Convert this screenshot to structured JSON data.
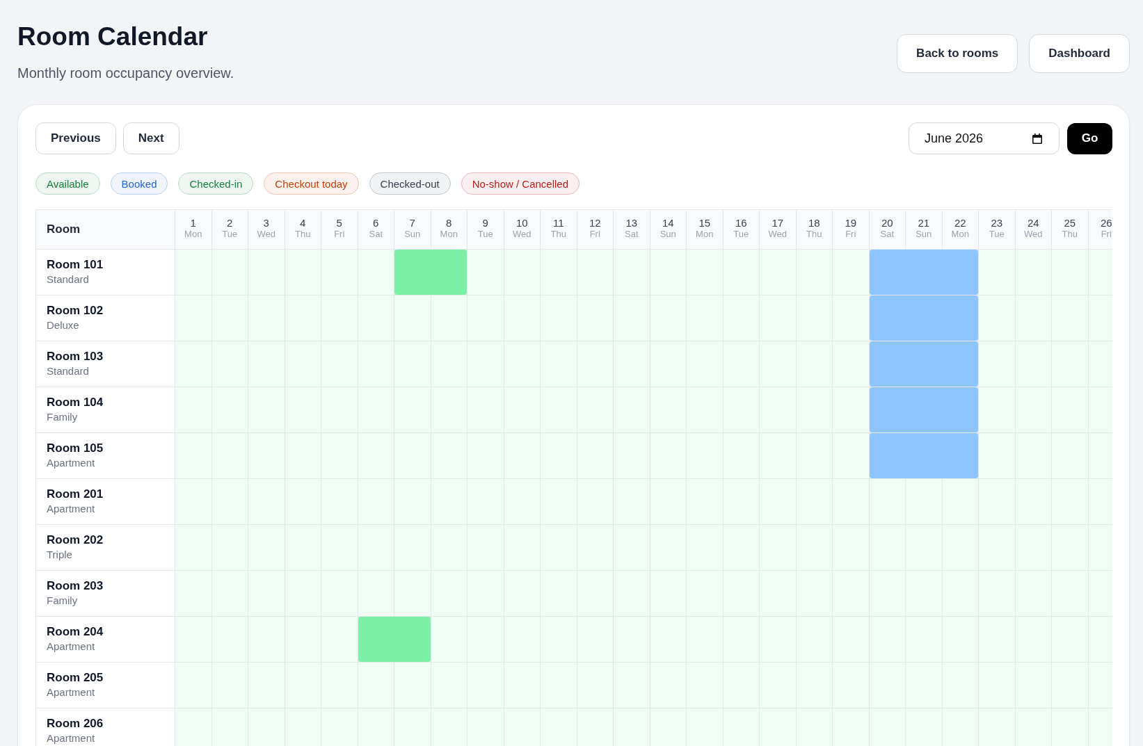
{
  "header": {
    "title": "Room Calendar",
    "subtitle": "Monthly room occupancy overview.",
    "buttons": [
      "Back to rooms",
      "Dashboard"
    ]
  },
  "toolbar": {
    "nav_buttons": [
      "Previous",
      "Next"
    ],
    "month_field": {
      "value": "June 2026"
    },
    "go_button": "Go"
  },
  "legend": [
    {
      "label": "Available",
      "color": "#15803d"
    },
    {
      "label": "Booked",
      "color": "#1d68d1"
    },
    {
      "label": "Checked-in",
      "color": "#15803d"
    },
    {
      "label": "Checkout today",
      "color": "#c2410c"
    },
    {
      "label": "Checked-out",
      "color": "#374151"
    },
    {
      "label": "No-show / Cancelled",
      "color": "#b91c1c"
    }
  ],
  "calendar": {
    "room_heading": "Room",
    "days": [
      {
        "date": "1",
        "weekday": "Mon"
      },
      {
        "date": "2",
        "weekday": "Tue"
      },
      {
        "date": "3",
        "weekday": "Wed"
      },
      {
        "date": "4",
        "weekday": "Thu"
      },
      {
        "date": "5",
        "weekday": "Fri"
      },
      {
        "date": "6",
        "weekday": "Sat"
      },
      {
        "date": "7",
        "weekday": "Sun"
      },
      {
        "date": "8",
        "weekday": "Mon"
      },
      {
        "date": "9",
        "weekday": "Tue"
      },
      {
        "date": "10",
        "weekday": "Wed"
      },
      {
        "date": "11",
        "weekday": "Thu"
      },
      {
        "date": "12",
        "weekday": "Fri"
      },
      {
        "date": "13",
        "weekday": "Sat"
      },
      {
        "date": "14",
        "weekday": "Sun"
      },
      {
        "date": "15",
        "weekday": "Mon"
      },
      {
        "date": "16",
        "weekday": "Tue"
      },
      {
        "date": "17",
        "weekday": "Wed"
      },
      {
        "date": "18",
        "weekday": "Thu"
      },
      {
        "date": "19",
        "weekday": "Fri"
      },
      {
        "date": "20",
        "weekday": "Sat"
      },
      {
        "date": "21",
        "weekday": "Sun"
      },
      {
        "date": "22",
        "weekday": "Mon"
      },
      {
        "date": "23",
        "weekday": "Tue"
      },
      {
        "date": "24",
        "weekday": "Wed"
      },
      {
        "date": "25",
        "weekday": "Thu"
      },
      {
        "date": "26",
        "weekday": "Fri"
      }
    ],
    "rooms": [
      {
        "name": "Room 101",
        "type": "Standard",
        "cells": [
          {
            "kind": "available"
          },
          {
            "kind": "available"
          },
          {
            "kind": "available"
          },
          {
            "kind": "available"
          },
          {
            "kind": "available"
          },
          {
            "kind": "available"
          },
          {
            "kind": "checked-in"
          },
          {
            "kind": "checked-in"
          },
          {
            "kind": "available"
          },
          {
            "kind": "available"
          },
          {
            "kind": "available"
          },
          {
            "kind": "available"
          },
          {
            "kind": "available"
          },
          {
            "kind": "available"
          },
          {
            "kind": "available"
          },
          {
            "kind": "available"
          },
          {
            "kind": "available"
          },
          {
            "kind": "available"
          },
          {
            "kind": "available"
          },
          {
            "kind": "booked"
          },
          {
            "kind": "booked"
          },
          {
            "kind": "booked"
          },
          {
            "kind": "available"
          },
          {
            "kind": "available"
          },
          {
            "kind": "available"
          },
          {
            "kind": "available"
          }
        ]
      },
      {
        "name": "Room 102",
        "type": "Deluxe",
        "cells": [
          {
            "kind": "available"
          },
          {
            "kind": "available"
          },
          {
            "kind": "available"
          },
          {
            "kind": "available"
          },
          {
            "kind": "available"
          },
          {
            "kind": "available"
          },
          {
            "kind": "available"
          },
          {
            "kind": "available"
          },
          {
            "kind": "available"
          },
          {
            "kind": "available"
          },
          {
            "kind": "available"
          },
          {
            "kind": "available"
          },
          {
            "kind": "available"
          },
          {
            "kind": "available"
          },
          {
            "kind": "available"
          },
          {
            "kind": "available"
          },
          {
            "kind": "available"
          },
          {
            "kind": "available"
          },
          {
            "kind": "available"
          },
          {
            "kind": "booked"
          },
          {
            "kind": "booked"
          },
          {
            "kind": "booked"
          },
          {
            "kind": "available"
          },
          {
            "kind": "available"
          },
          {
            "kind": "available"
          },
          {
            "kind": "available"
          }
        ]
      },
      {
        "name": "Room 103",
        "type": "Standard",
        "cells": [
          {
            "kind": "available"
          },
          {
            "kind": "available"
          },
          {
            "kind": "available"
          },
          {
            "kind": "available"
          },
          {
            "kind": "available"
          },
          {
            "kind": "available"
          },
          {
            "kind": "available"
          },
          {
            "kind": "available"
          },
          {
            "kind": "available"
          },
          {
            "kind": "available"
          },
          {
            "kind": "available"
          },
          {
            "kind": "available"
          },
          {
            "kind": "available"
          },
          {
            "kind": "available"
          },
          {
            "kind": "available"
          },
          {
            "kind": "available"
          },
          {
            "kind": "available"
          },
          {
            "kind": "available"
          },
          {
            "kind": "available"
          },
          {
            "kind": "booked"
          },
          {
            "kind": "booked"
          },
          {
            "kind": "booked"
          },
          {
            "kind": "available"
          },
          {
            "kind": "available"
          },
          {
            "kind": "available"
          },
          {
            "kind": "available"
          }
        ]
      },
      {
        "name": "Room 104",
        "type": "Family",
        "cells": [
          {
            "kind": "available"
          },
          {
            "kind": "available"
          },
          {
            "kind": "available"
          },
          {
            "kind": "available"
          },
          {
            "kind": "available"
          },
          {
            "kind": "available"
          },
          {
            "kind": "available"
          },
          {
            "kind": "available"
          },
          {
            "kind": "available"
          },
          {
            "kind": "available"
          },
          {
            "kind": "available"
          },
          {
            "kind": "available"
          },
          {
            "kind": "available"
          },
          {
            "kind": "available"
          },
          {
            "kind": "available"
          },
          {
            "kind": "available"
          },
          {
            "kind": "available"
          },
          {
            "kind": "available"
          },
          {
            "kind": "available"
          },
          {
            "kind": "booked"
          },
          {
            "kind": "booked"
          },
          {
            "kind": "booked"
          },
          {
            "kind": "available"
          },
          {
            "kind": "available"
          },
          {
            "kind": "available"
          },
          {
            "kind": "available"
          }
        ]
      },
      {
        "name": "Room 105",
        "type": "Apartment",
        "cells": [
          {
            "kind": "available"
          },
          {
            "kind": "available"
          },
          {
            "kind": "available"
          },
          {
            "kind": "available"
          },
          {
            "kind": "available"
          },
          {
            "kind": "available"
          },
          {
            "kind": "available"
          },
          {
            "kind": "available"
          },
          {
            "kind": "available"
          },
          {
            "kind": "available"
          },
          {
            "kind": "available"
          },
          {
            "kind": "available"
          },
          {
            "kind": "available"
          },
          {
            "kind": "available"
          },
          {
            "kind": "available"
          },
          {
            "kind": "available"
          },
          {
            "kind": "available"
          },
          {
            "kind": "available"
          },
          {
            "kind": "available"
          },
          {
            "kind": "booked"
          },
          {
            "kind": "booked"
          },
          {
            "kind": "booked"
          },
          {
            "kind": "available"
          },
          {
            "kind": "available"
          },
          {
            "kind": "available"
          },
          {
            "kind": "available"
          }
        ]
      },
      {
        "name": "Room 201",
        "type": "Apartment",
        "cells": [
          {
            "kind": "available"
          },
          {
            "kind": "available"
          },
          {
            "kind": "available"
          },
          {
            "kind": "available"
          },
          {
            "kind": "available"
          },
          {
            "kind": "available"
          },
          {
            "kind": "available"
          },
          {
            "kind": "available"
          },
          {
            "kind": "available"
          },
          {
            "kind": "available"
          },
          {
            "kind": "available"
          },
          {
            "kind": "available"
          },
          {
            "kind": "available"
          },
          {
            "kind": "available"
          },
          {
            "kind": "available"
          },
          {
            "kind": "available"
          },
          {
            "kind": "available"
          },
          {
            "kind": "available"
          },
          {
            "kind": "available"
          },
          {
            "kind": "available"
          },
          {
            "kind": "available"
          },
          {
            "kind": "available"
          },
          {
            "kind": "available"
          },
          {
            "kind": "available"
          },
          {
            "kind": "available"
          },
          {
            "kind": "available"
          }
        ]
      },
      {
        "name": "Room 202",
        "type": "Triple",
        "cells": [
          {
            "kind": "available"
          },
          {
            "kind": "available"
          },
          {
            "kind": "available"
          },
          {
            "kind": "available"
          },
          {
            "kind": "available"
          },
          {
            "kind": "available"
          },
          {
            "kind": "available"
          },
          {
            "kind": "available"
          },
          {
            "kind": "available"
          },
          {
            "kind": "available"
          },
          {
            "kind": "available"
          },
          {
            "kind": "available"
          },
          {
            "kind": "available"
          },
          {
            "kind": "available"
          },
          {
            "kind": "available"
          },
          {
            "kind": "available"
          },
          {
            "kind": "available"
          },
          {
            "kind": "available"
          },
          {
            "kind": "available"
          },
          {
            "kind": "available"
          },
          {
            "kind": "available"
          },
          {
            "kind": "available"
          },
          {
            "kind": "available"
          },
          {
            "kind": "available"
          },
          {
            "kind": "available"
          },
          {
            "kind": "available"
          }
        ]
      },
      {
        "name": "Room 203",
        "type": "Family",
        "cells": [
          {
            "kind": "available"
          },
          {
            "kind": "available"
          },
          {
            "kind": "available"
          },
          {
            "kind": "available"
          },
          {
            "kind": "available"
          },
          {
            "kind": "available"
          },
          {
            "kind": "available"
          },
          {
            "kind": "available"
          },
          {
            "kind": "available"
          },
          {
            "kind": "available"
          },
          {
            "kind": "available"
          },
          {
            "kind": "available"
          },
          {
            "kind": "available"
          },
          {
            "kind": "available"
          },
          {
            "kind": "available"
          },
          {
            "kind": "available"
          },
          {
            "kind": "available"
          },
          {
            "kind": "available"
          },
          {
            "kind": "available"
          },
          {
            "kind": "available"
          },
          {
            "kind": "available"
          },
          {
            "kind": "available"
          },
          {
            "kind": "available"
          },
          {
            "kind": "available"
          },
          {
            "kind": "available"
          },
          {
            "kind": "available"
          }
        ]
      },
      {
        "name": "Room 204",
        "type": "Apartment",
        "cells": [
          {
            "kind": "available"
          },
          {
            "kind": "available"
          },
          {
            "kind": "available"
          },
          {
            "kind": "available"
          },
          {
            "kind": "available"
          },
          {
            "kind": "checked-in"
          },
          {
            "kind": "checked-in"
          },
          {
            "kind": "available"
          },
          {
            "kind": "available"
          },
          {
            "kind": "available"
          },
          {
            "kind": "available"
          },
          {
            "kind": "available"
          },
          {
            "kind": "available"
          },
          {
            "kind": "available"
          },
          {
            "kind": "available"
          },
          {
            "kind": "available"
          },
          {
            "kind": "available"
          },
          {
            "kind": "available"
          },
          {
            "kind": "available"
          },
          {
            "kind": "available"
          },
          {
            "kind": "available"
          },
          {
            "kind": "available"
          },
          {
            "kind": "available"
          },
          {
            "kind": "available"
          },
          {
            "kind": "available"
          },
          {
            "kind": "available"
          }
        ]
      },
      {
        "name": "Room 205",
        "type": "Apartment",
        "cells": [
          {
            "kind": "available"
          },
          {
            "kind": "available"
          },
          {
            "kind": "available"
          },
          {
            "kind": "available"
          },
          {
            "kind": "available"
          },
          {
            "kind": "available"
          },
          {
            "kind": "available"
          },
          {
            "kind": "available"
          },
          {
            "kind": "available"
          },
          {
            "kind": "available"
          },
          {
            "kind": "available"
          },
          {
            "kind": "available"
          },
          {
            "kind": "available"
          },
          {
            "kind": "available"
          },
          {
            "kind": "available"
          },
          {
            "kind": "available"
          },
          {
            "kind": "available"
          },
          {
            "kind": "available"
          },
          {
            "kind": "available"
          },
          {
            "kind": "available"
          },
          {
            "kind": "available"
          },
          {
            "kind": "available"
          },
          {
            "kind": "available"
          },
          {
            "kind": "available"
          },
          {
            "kind": "available"
          },
          {
            "kind": "available"
          }
        ]
      },
      {
        "name": "Room 206",
        "type": "Apartment",
        "cells": [
          {
            "kind": "available"
          },
          {
            "kind": "available"
          },
          {
            "kind": "available"
          },
          {
            "kind": "available"
          },
          {
            "kind": "available"
          },
          {
            "kind": "available"
          },
          {
            "kind": "available"
          },
          {
            "kind": "available"
          },
          {
            "kind": "available"
          },
          {
            "kind": "available"
          },
          {
            "kind": "available"
          },
          {
            "kind": "available"
          },
          {
            "kind": "available"
          },
          {
            "kind": "available"
          },
          {
            "kind": "available"
          },
          {
            "kind": "available"
          },
          {
            "kind": "available"
          },
          {
            "kind": "available"
          },
          {
            "kind": "available"
          },
          {
            "kind": "available"
          },
          {
            "kind": "available"
          },
          {
            "kind": "available"
          },
          {
            "kind": "available"
          },
          {
            "kind": "available"
          },
          {
            "kind": "available"
          },
          {
            "kind": "available"
          }
        ]
      }
    ]
  }
}
